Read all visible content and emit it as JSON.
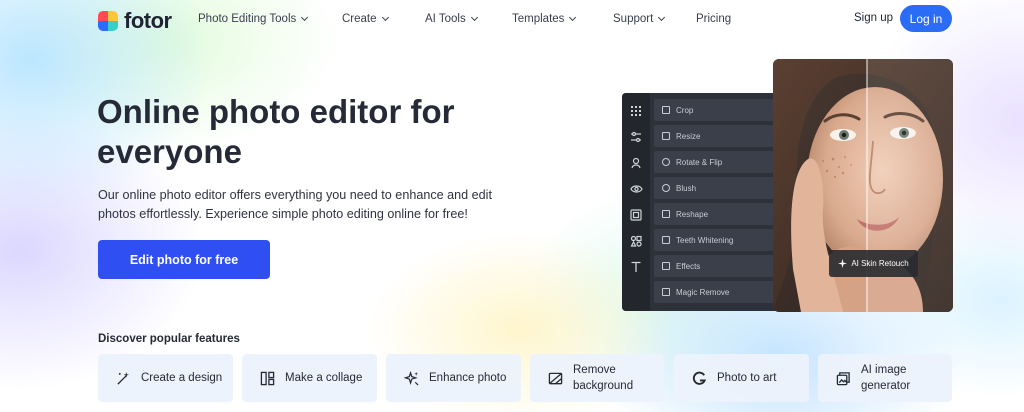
{
  "brand": {
    "name": "fotor"
  },
  "nav": {
    "items": [
      {
        "label": "Photo Editing Tools",
        "has_dropdown": true
      },
      {
        "label": "Create",
        "has_dropdown": true
      },
      {
        "label": "AI Tools",
        "has_dropdown": true
      },
      {
        "label": "Templates",
        "has_dropdown": true
      },
      {
        "label": "Support",
        "has_dropdown": true
      },
      {
        "label": "Pricing",
        "has_dropdown": false
      }
    ],
    "signup_label": "Sign up",
    "login_label": "Log in"
  },
  "hero": {
    "title": "Online photo editor for everyone",
    "description": "Our online photo editor offers everything you need to enhance and edit photos effortlessly. Experience simple photo editing online for free!",
    "cta_label": "Edit photo for free"
  },
  "editor_mock": {
    "menu": [
      "Crop",
      "Resize",
      "Rotate & Flip",
      "Blush",
      "Reshape",
      "Teeth Whitening",
      "Effects",
      "Magic Remove"
    ],
    "badge_label": "AI Skin Retouch"
  },
  "features": {
    "heading": "Discover popular features",
    "items": [
      {
        "label": "Create a design",
        "icon": "magic-wand-icon"
      },
      {
        "label": "Make a collage",
        "icon": "collage-icon"
      },
      {
        "label": "Enhance photo",
        "icon": "sparkle-icon"
      },
      {
        "label": "Remove background",
        "icon": "remove-background-icon"
      },
      {
        "label": "Photo to art",
        "icon": "art-g-icon"
      },
      {
        "label": "AI image generator",
        "icon": "ai-image-icon"
      }
    ]
  },
  "colors": {
    "primary_button": "#2f4ff2",
    "login_button": "#2b6cf6",
    "text_dark": "#262a36",
    "feature_card_bg": "#ecf2fc",
    "editor_panel_bg": "#2d3139"
  }
}
